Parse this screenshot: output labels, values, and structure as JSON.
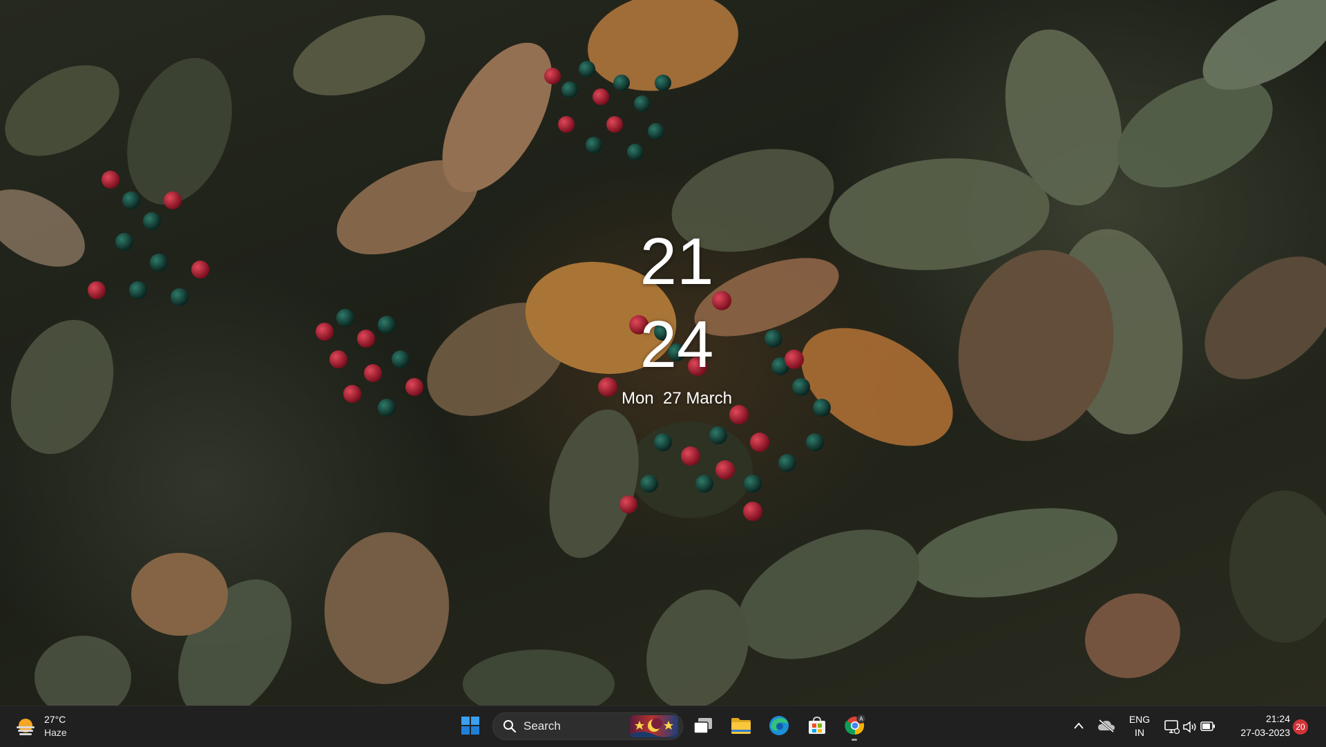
{
  "lock_clock": {
    "hour": "21",
    "minute": "24",
    "date": "Mon  27 March"
  },
  "taskbar": {
    "weather": {
      "temperature": "27°C",
      "condition": "Haze",
      "icon": "haze-sun-icon"
    },
    "start": {
      "icon": "windows-start-icon"
    },
    "search": {
      "label": "Search",
      "icon": "search-icon"
    },
    "pinned_apps": [
      {
        "name": "Task View",
        "icon": "task-view-icon"
      },
      {
        "name": "File Explorer",
        "icon": "folder-icon"
      },
      {
        "name": "Microsoft Edge",
        "icon": "edge-icon"
      },
      {
        "name": "Microsoft Store",
        "icon": "store-icon"
      },
      {
        "name": "Google Chrome",
        "icon": "chrome-icon"
      }
    ],
    "tray": {
      "language_line1": "ENG",
      "language_line2": "IN",
      "time": "21:24",
      "date": "27-03-2023",
      "notification_count": "20"
    }
  },
  "colors": {
    "taskbar_bg": "#202020",
    "accent_blue": "#0078d4",
    "badge_red": "#d13438"
  }
}
